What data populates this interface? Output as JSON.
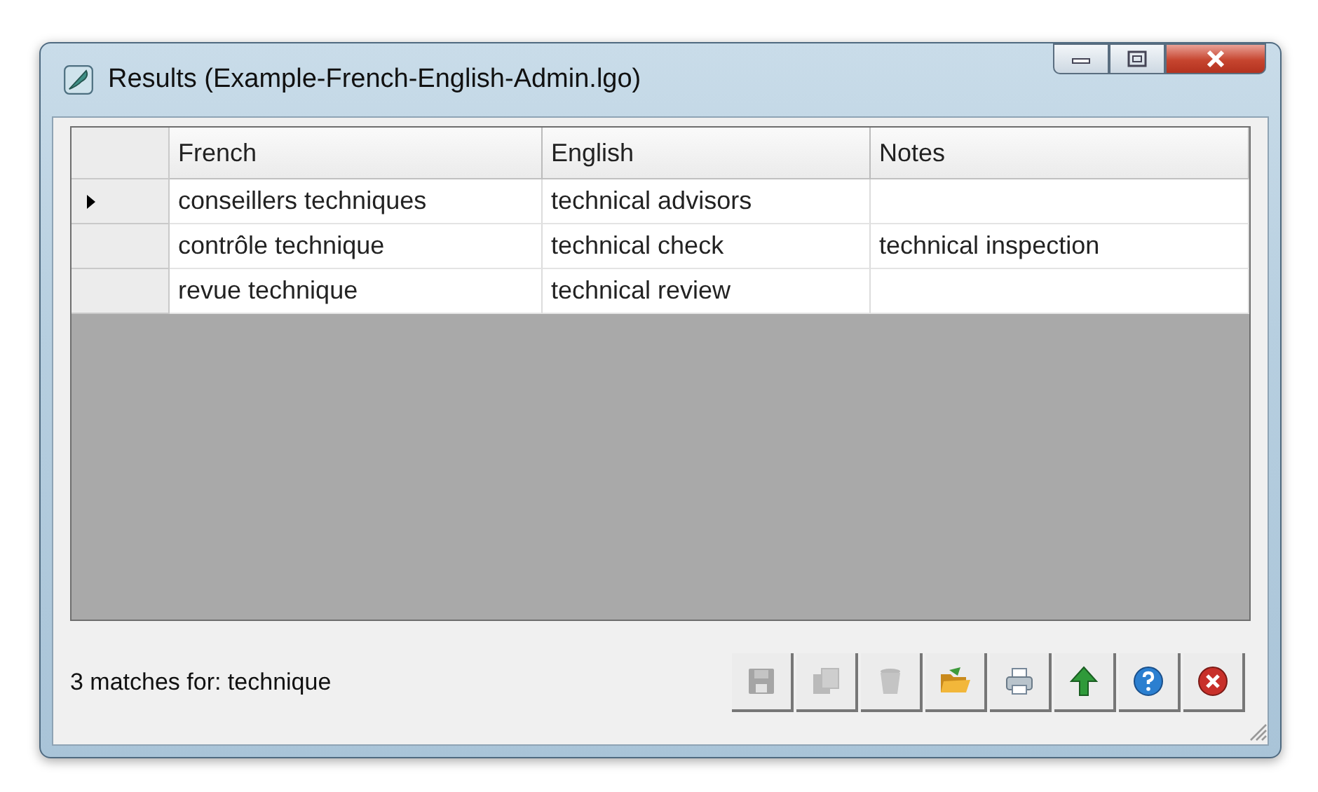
{
  "window": {
    "title": "Results (Example-French-English-Admin.lgo)"
  },
  "table": {
    "columns": [
      "French",
      "English",
      "Notes"
    ],
    "rows": [
      {
        "current": true,
        "cells": [
          "conseillers techniques",
          "technical advisors",
          ""
        ]
      },
      {
        "current": false,
        "cells": [
          "contrôle technique",
          "technical check",
          "technical inspection"
        ]
      },
      {
        "current": false,
        "cells": [
          "revue technique",
          "technical review",
          ""
        ]
      }
    ]
  },
  "status_bar": {
    "text": "3 matches for: technique"
  },
  "toolbar": [
    {
      "kind": "save",
      "disabled": true
    },
    {
      "kind": "copy",
      "disabled": true
    },
    {
      "kind": "delete",
      "disabled": true
    },
    {
      "kind": "open",
      "disabled": false
    },
    {
      "kind": "print",
      "disabled": false
    },
    {
      "kind": "up",
      "disabled": false
    },
    {
      "kind": "help",
      "disabled": false
    },
    {
      "kind": "close",
      "disabled": false
    }
  ]
}
